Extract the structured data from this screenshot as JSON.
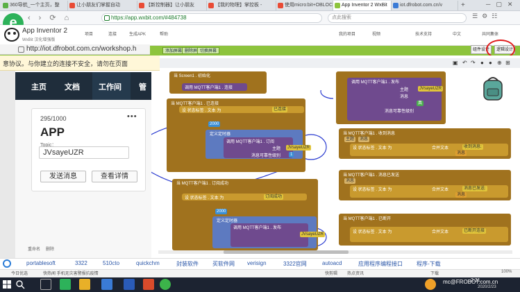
{
  "browser": {
    "tabs": [
      {
        "label": "360导航_一个主页，整",
        "color": "#5ab047"
      },
      {
        "label": "让小朋友们掌握自动",
        "color": "#e94b35"
      },
      {
        "label": "【新控制器】让小朋友",
        "color": "#e94b35"
      },
      {
        "label": "【我的物理】掌控板 -",
        "color": "#e94b35"
      },
      {
        "label": "使用micro:bit+OBLOC",
        "color": "#e94b35"
      },
      {
        "label": "App Inventor 2 WxBit",
        "color": "#8dc43d"
      },
      {
        "label": "iot.dfrobot.com.cn/v",
        "color": "#3b7bd6"
      }
    ],
    "url": "https://app.wxbit.com/#484738",
    "search_placeholder": "点此搜索"
  },
  "appinventor": {
    "title": "App Inventor 2",
    "subtitle": "WxBit 汉化增强版",
    "menu": [
      "项目",
      "连接",
      "生成APK",
      "帮助"
    ],
    "right_menu": [
      "我的项目",
      "视频",
      "技术支持",
      "中文",
      "共同集体"
    ],
    "toolbar_buttons": [
      "添加屏幕",
      "删除屏幕",
      "切换屏幕"
    ],
    "designer_button": "组件设计",
    "blocks_button": "逻辑设计"
  },
  "iot": {
    "url": "http://iot.dfrobot.com.cn/workshop.h",
    "warning": "意协议。与你建立的连接不安全，请勿在页面",
    "nav": [
      "主页",
      "文档",
      "工作间",
      "管"
    ],
    "count": "295/1000",
    "app_title": "APP",
    "topic_label": "Topic：",
    "topic_value": "JVsayeUZR",
    "send_button": "发送消息",
    "details_button": "查看详情",
    "side_labels": [
      "重命名",
      "删除"
    ]
  },
  "blocks": {
    "screen_init": "当 Screen1 . 初始化",
    "connect_label": "调用 MQTT客户端1 . 连接",
    "connected": "当 MQTT客户端1 . 已连接",
    "subscribe": "调用 MQTT客户端1 . 订阅",
    "topic": "主题",
    "qos": "消息可靠性级别",
    "topic_value": "JVsayeUZR",
    "qos_value": "1",
    "publish": "调用 MQTT客户端1 . 发布",
    "publish_text": "JVsayeUZR",
    "msg_received": "当 MQTT客户端1 . 收到消息",
    "msg_sent": "当 MQTT客户端1 . 消息已发送",
    "sub_success": "当 MQTT客户端1 . 订阅成功",
    "disconnected": "当 MQTT客户端1 . 已断开",
    "set_label": "设 状态标签 . 文本 为",
    "join": "合并文本",
    "connected_text": "已连接",
    "received_text": "收到消息:",
    "sent_text": "消息已发送:",
    "subscribed_text": "订阅成功",
    "disconnected_text": "已断开连接",
    "param_msg": "消息",
    "param_topic": "主题",
    "timer_ms": "2000",
    "timer": "定义定时器",
    "yes": "真",
    "num": "2000"
  },
  "bookmarks": [
    "portablesoft",
    "3322",
    "510cto",
    "quickchm",
    "封装软件",
    "买软件网",
    "verisign",
    "3322官网",
    "autoacd",
    "应用程序编程接口",
    "程序-下载"
  ],
  "status_items": [
    "今日优选",
    "快热闻  手机无灾害警报抗疫情",
    "快剪辑",
    "热点资讯",
    "下载",
    "100%"
  ],
  "taskbar": {
    "time": "2:31",
    "date": "2020/2/23",
    "watermark": "mc@FROBOT.com.cn"
  }
}
